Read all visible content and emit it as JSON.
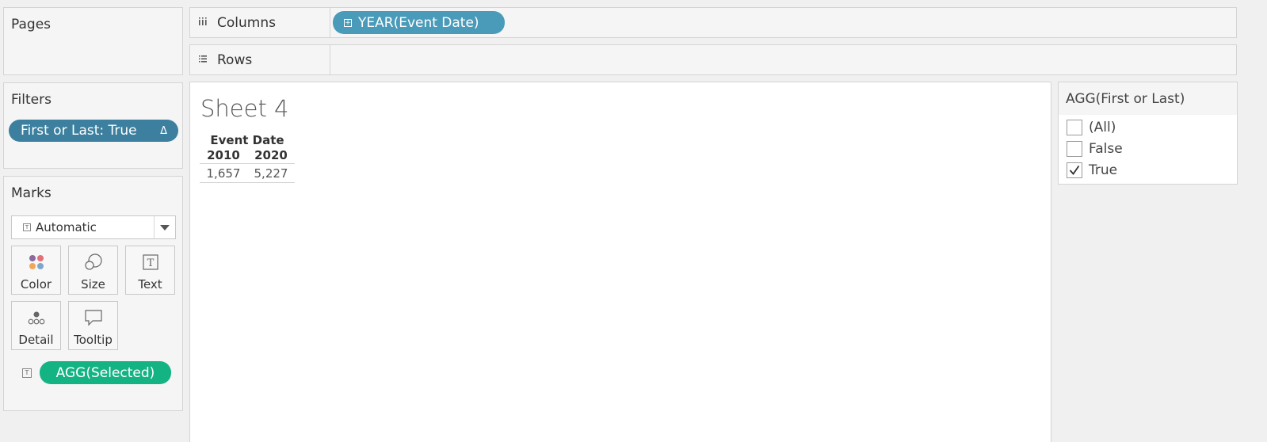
{
  "pages": {
    "title": "Pages"
  },
  "filters": {
    "title": "Filters",
    "pill_label": "First or Last: True",
    "pill_delta": "Δ"
  },
  "marks": {
    "title": "Marks",
    "mark_type": "Automatic",
    "buttons": [
      {
        "label": "Color",
        "icon": "color-icon"
      },
      {
        "label": "Size",
        "icon": "size-icon"
      },
      {
        "label": "Text",
        "icon": "text-icon"
      },
      {
        "label": "Detail",
        "icon": "detail-icon"
      },
      {
        "label": "Tooltip",
        "icon": "tooltip-icon"
      }
    ],
    "text_pill": "AGG(Selected)"
  },
  "shelves": {
    "columns_label": "Columns",
    "columns_pill": "YEAR(Event Date)",
    "rows_label": "Rows"
  },
  "sheet": {
    "title": "Sheet 4",
    "header": "Event Date",
    "columns": [
      "2010",
      "2020"
    ],
    "values": [
      "1,657",
      "5,227"
    ]
  },
  "quick_filter": {
    "title": "AGG(First or Last)",
    "options": [
      {
        "label": "(All)",
        "checked": false
      },
      {
        "label": "False",
        "checked": false
      },
      {
        "label": "True",
        "checked": true
      }
    ]
  },
  "colors": {
    "filter_pill": "#3c7f9e",
    "columns_pill": "#4a9bb9",
    "agg_pill": "#14b383",
    "color_dots": [
      "#8c6b9a",
      "#e0707a",
      "#f2a65a",
      "#7ea6c9"
    ]
  }
}
